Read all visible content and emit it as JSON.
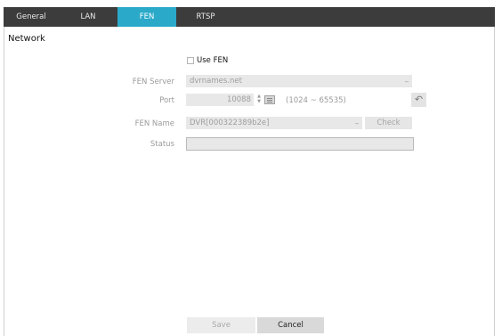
{
  "tabs": [
    {
      "label": "General"
    },
    {
      "label": "LAN"
    },
    {
      "label": "FEN"
    },
    {
      "label": "RTSP"
    }
  ],
  "active_tab": "FEN",
  "section": {
    "title": "Network"
  },
  "use_fen": {
    "label": "Use FEN",
    "checked": false
  },
  "fen_server": {
    "label": "FEN Server",
    "value": "dvrnames.net"
  },
  "port": {
    "label": "Port",
    "value": "10088",
    "range": "(1024 ~ 65535)"
  },
  "fen_name": {
    "label": "FEN Name",
    "value": "DVR[000322389b2e]",
    "check_label": "Check"
  },
  "status": {
    "label": "Status",
    "value": ""
  },
  "buttons": {
    "save": "Save",
    "cancel": "Cancel"
  },
  "colors": {
    "tab_bar": "#3c3c3c",
    "active_tab": "#2aa9c9",
    "field_bg": "#e8e8e8"
  },
  "icons": [
    "keyboard-icon",
    "reset-icon",
    "spin-up-icon",
    "spin-down-icon"
  ]
}
